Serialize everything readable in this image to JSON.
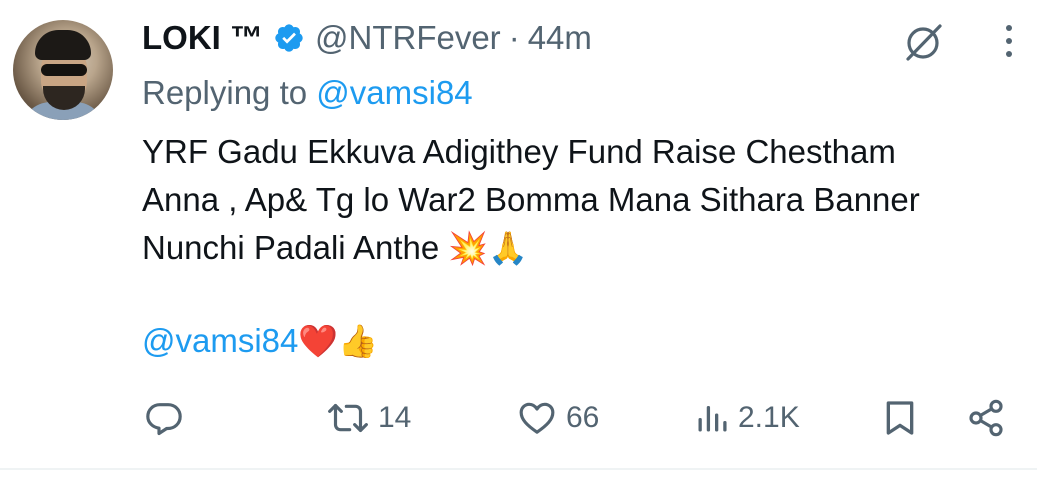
{
  "tweet": {
    "author_name": "LOKI ™",
    "handle": "@NTRFever",
    "separator": "·",
    "time": "44m",
    "reply_prefix": "Replying to",
    "reply_to": "@vamsi84",
    "text_lines": [
      "YRF Gadu Ekkuva Adigithey Fund Raise Chestham",
      "Anna , Ap& Tg lo War2 Bomma Mana Sithara Banner",
      "Nunchi Padali Anthe"
    ],
    "text_line3_emoji": "💥🙏",
    "mention": "@vamsi84",
    "mention_emoji": "❤️👍"
  },
  "actions": {
    "replies": "",
    "reposts": "14",
    "likes": "66",
    "views": "2.1K"
  },
  "icons": {
    "verified": "verified-badge-icon",
    "grok": "grok-icon",
    "more": "more-vertical-icon",
    "reply": "reply-icon",
    "repost": "repost-icon",
    "like": "heart-icon",
    "views": "views-icon",
    "bookmark": "bookmark-icon",
    "share": "share-icon"
  },
  "colors": {
    "text": "#0f1419",
    "secondary": "#536471",
    "link": "#1d9bf0",
    "verified": "#1d9bf0"
  }
}
